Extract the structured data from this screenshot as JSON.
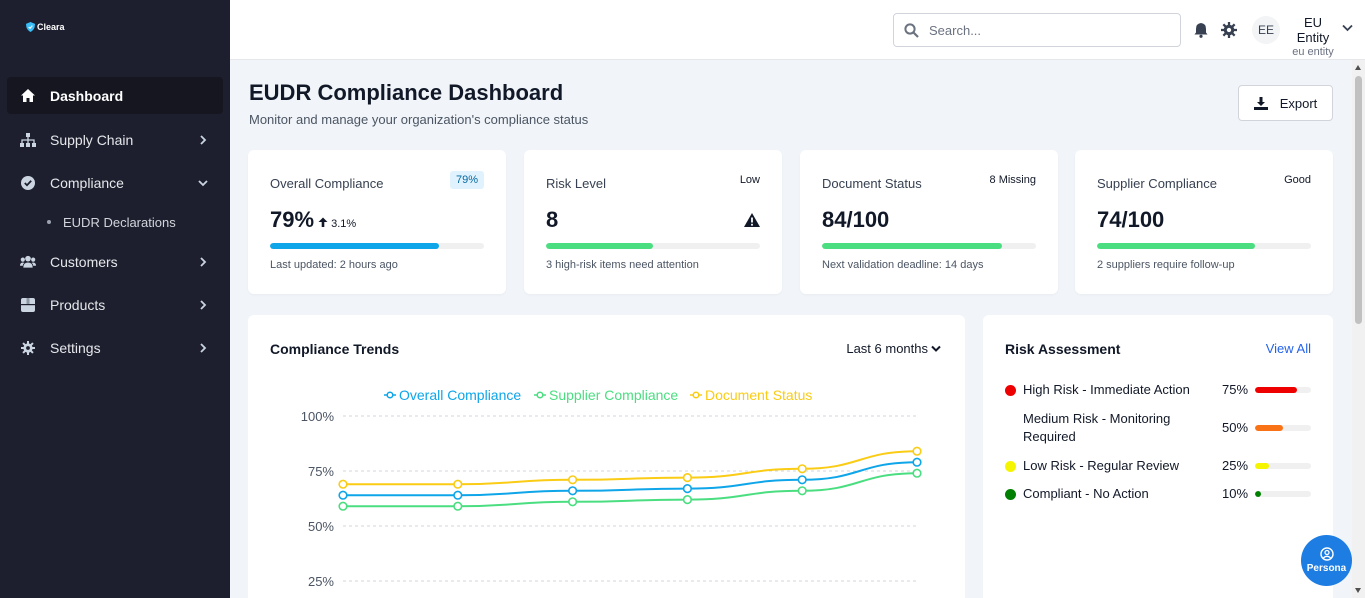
{
  "brand": {
    "name": "Cleara"
  },
  "sidebar": {
    "items": [
      {
        "label": "Dashboard",
        "icon": "home-icon",
        "active": true
      },
      {
        "label": "Supply Chain",
        "icon": "sitemap-icon"
      },
      {
        "label": "Compliance",
        "icon": "check-circle-icon",
        "expanded": true
      },
      {
        "label": "Customers",
        "icon": "users-icon"
      },
      {
        "label": "Products",
        "icon": "box-icon"
      },
      {
        "label": "Settings",
        "icon": "gear-icon"
      }
    ],
    "sub_items": [
      {
        "label": "EUDR Declarations"
      }
    ]
  },
  "topbar": {
    "search_placeholder": "Search...",
    "avatar_initials": "EE",
    "user_name": "EU Entity",
    "user_sub": "eu entity"
  },
  "page": {
    "title": "EUDR Compliance Dashboard",
    "subtitle": "Monitor and manage your organization's compliance status",
    "export_label": "Export"
  },
  "cards": [
    {
      "label": "Overall Compliance",
      "badge": "79%",
      "value": "79%",
      "delta": "3.1%",
      "progress": 0.79,
      "color": "#0ea5e9",
      "footer": "Last updated: 2 hours ago"
    },
    {
      "label": "Risk Level",
      "badge": "Low",
      "value": "8",
      "progress": 0.5,
      "color": "#4ade80",
      "footer": "3 high-risk items need attention"
    },
    {
      "label": "Document Status",
      "badge": "8 Missing",
      "value": "84/100",
      "progress": 0.84,
      "color": "#4ade80",
      "footer": "Next validation deadline: 14 days"
    },
    {
      "label": "Supplier Compliance",
      "badge": "Good",
      "value": "74/100",
      "progress": 0.74,
      "color": "#4ade80",
      "footer": "2 suppliers require follow-up"
    }
  ],
  "trends": {
    "title": "Compliance Trends",
    "range": "Last 6 months"
  },
  "chart_data": {
    "type": "line",
    "x": [
      1,
      2,
      3,
      4,
      5,
      6
    ],
    "series": [
      {
        "name": "Overall Compliance",
        "color": "#0ea5e9",
        "values": [
          64,
          64,
          66,
          67,
          71,
          79
        ]
      },
      {
        "name": "Supplier Compliance",
        "color": "#4ade80",
        "values": [
          59,
          59,
          61,
          62,
          66,
          74
        ]
      },
      {
        "name": "Document Status",
        "color": "#facc15",
        "values": [
          69,
          69,
          71,
          72,
          76,
          84
        ]
      }
    ],
    "yticks": [
      "100%",
      "75%",
      "50%",
      "25%"
    ],
    "ylim": [
      0,
      100
    ],
    "grid": true,
    "legend": "top"
  },
  "risk": {
    "title": "Risk Assessment",
    "view_all": "View All",
    "items": [
      {
        "label": "High Risk - Immediate Action",
        "pct": "75%",
        "value": 0.75,
        "color": "#ef0000",
        "dot": true
      },
      {
        "label": "Medium Risk - Monitoring Required",
        "pct": "50%",
        "value": 0.5,
        "color": "#f97316",
        "dot": false
      },
      {
        "label": "Low Risk - Regular Review",
        "pct": "25%",
        "value": 0.25,
        "color": "#f5f500",
        "dot": true
      },
      {
        "label": "Compliant - No Action",
        "pct": "10%",
        "value": 0.1,
        "color": "#008000",
        "dot": true
      }
    ]
  },
  "persona": {
    "label": "Persona"
  }
}
